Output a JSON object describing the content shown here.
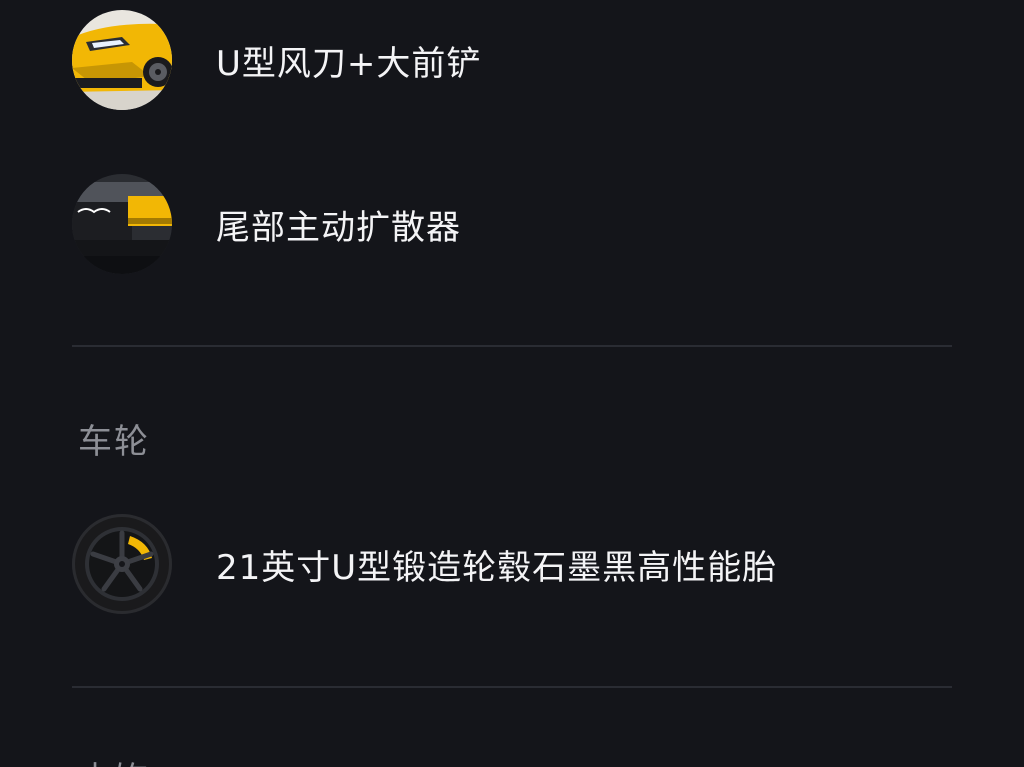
{
  "options": {
    "front_aero": {
      "label": "U型风刀+大前铲",
      "icon": "car-front-thumbnail"
    },
    "rear_diffuser": {
      "label": "尾部主动扩散器",
      "icon": "car-rear-thumbnail"
    },
    "wheels_item": {
      "label": "21英寸U型锻造轮毂石墨黑高性能胎",
      "icon": "wheel-thumbnail"
    }
  },
  "sections": {
    "wheels": {
      "title": "车轮"
    },
    "interior": {
      "title": "内饰"
    }
  },
  "colors": {
    "background": "#14151a",
    "divider": "#2a2c33",
    "accent_yellow": "#f2b705",
    "section_title": "#8d8f96"
  }
}
